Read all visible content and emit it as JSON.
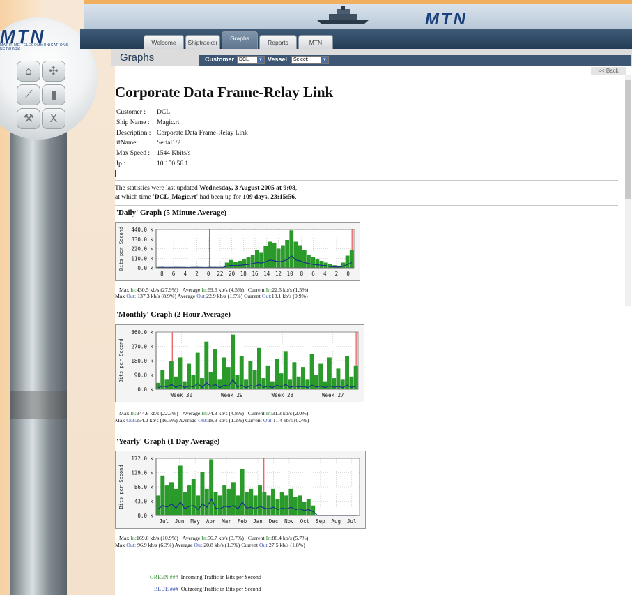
{
  "brand": {
    "logo": "MTN",
    "tagline": "MARITIME TELECOMMUNICATIONS NETWORK"
  },
  "nav": {
    "tabs": [
      {
        "label": "Welcome",
        "active": false
      },
      {
        "label": "Shiptracker",
        "active": false
      },
      {
        "label": "Graphs",
        "active": true
      },
      {
        "label": "Reports",
        "active": false
      },
      {
        "label": "MTN",
        "active": false
      }
    ]
  },
  "subbar": {
    "title": "Graphs",
    "customer_label": "Customer",
    "customer_value": "DCL",
    "vessel_label": "Vessel",
    "vessel_value": "Select:"
  },
  "back_label": "<< Back",
  "side_icons": [
    "home-icon",
    "network-icon",
    "graph-icon",
    "bar-chart-icon",
    "tools-icon",
    "close-icon"
  ],
  "page": {
    "heading": "Corporate Data Frame-Relay Link",
    "info": [
      {
        "key": "Customer :",
        "value": "DCL"
      },
      {
        "key": "Ship Name :",
        "value": "Magic.rt"
      },
      {
        "key": "Description :",
        "value": "Corporate Data Frame-Relay Link"
      },
      {
        "key": "ifName :",
        "value": "Serial1/2"
      },
      {
        "key": "Max Speed :",
        "value": "1544 Kbits/s"
      },
      {
        "key": "Ip :",
        "value": "10.150.56.1"
      }
    ],
    "stats_line1_pre": "The statistics were last updated ",
    "stats_line1_bold": "Wednesday, 3 August 2005 at 9:08",
    "stats_line1_post": ",",
    "stats_line2_pre": "at which time ",
    "stats_line2_bold1": "'DCL_Magic.rt'",
    "stats_line2_mid": " had been up for ",
    "stats_line2_bold2": "109 days, 23:15:56",
    "stats_line2_post": "."
  },
  "colors": {
    "incoming": "#2a9a2a",
    "outgoing": "#1b2f8a",
    "highlight": "#e03030"
  },
  "graphs": [
    {
      "title": "'Daily' Graph (5 Minute Average)",
      "ylabel": "Bits per Second",
      "yticks": [
        "440.0 k",
        "330.0 k",
        "220.0 k",
        "110.0 k",
        "0.0 k"
      ],
      "xticks": [
        "8",
        "6",
        "4",
        "2",
        "0",
        "22",
        "20",
        "18",
        "16",
        "14",
        "12",
        "10",
        "8",
        "6",
        "4",
        "2",
        "0"
      ],
      "max_line": {
        "l1": "Max",
        "in_lbl": "In:",
        "in_val": "430.5 kb/s (27.9%)",
        "a1": "Average",
        "ain_lbl": "In:",
        "ain_val": "69.6 kb/s (4.5%)",
        "c1": "Current",
        "cin_lbl": "In:",
        "cin_val": "22.5 kb/s (1.5%)"
      },
      "out_line": {
        "l1": "Max",
        "out_lbl": "Out:",
        "out_val": " 137.3 kb/s (8.9%)",
        "a1": "Average",
        "aout_lbl": "Out:",
        "aout_val": "22.9 kb/s (1.5%)",
        "c1": "Current",
        "cout_lbl": "Out:",
        "cout_val": "13.1 kb/s (0.9%)"
      },
      "chart_data": {
        "type": "area",
        "series": [
          {
            "name": "In",
            "values": [
              10,
              12,
              8,
              9,
              11,
              10,
              9,
              8,
              10,
              12,
              9,
              8,
              11,
              10,
              9,
              10,
              60,
              90,
              70,
              80,
              100,
              120,
              150,
              200,
              180,
              250,
              300,
              280,
              220,
              260,
              320,
              430,
              300,
              260,
              200,
              150,
              120,
              100,
              80,
              60,
              40,
              30,
              25,
              60,
              140,
              200
            ]
          },
          {
            "name": "Out",
            "values": [
              5,
              6,
              5,
              5,
              6,
              5,
              5,
              4,
              5,
              6,
              5,
              4,
              6,
              5,
              5,
              5,
              20,
              30,
              25,
              30,
              35,
              40,
              50,
              60,
              55,
              70,
              90,
              80,
              70,
              75,
              95,
              137,
              90,
              80,
              60,
              50,
              40,
              35,
              30,
              25,
              15,
              12,
              10,
              20,
              40,
              60
            ]
          }
        ],
        "ylim": [
          0,
          440
        ]
      }
    },
    {
      "title": "'Monthly' Graph (2 Hour Average)",
      "ylabel": "Bits per Second",
      "yticks": [
        "360.0 k",
        "270.0 k",
        "180.0 k",
        "90.0 k",
        "0.0 k"
      ],
      "xticks": [
        "Week 30",
        "Week 29",
        "Week 28",
        "Week 27"
      ],
      "max_line": {
        "l1": "Max",
        "in_lbl": "In:",
        "in_val": "344.6 kb/s (22.3%)",
        "a1": "Average",
        "ain_lbl": "In:",
        "ain_val": "74.3 kb/s (4.8%)",
        "c1": "Current",
        "cin_lbl": "In:",
        "cin_val": "31.3 kb/s (2.0%)"
      },
      "out_line": {
        "l1": "Max",
        "out_lbl": "Out:",
        "out_val": "254.2 kb/s (16.5%)",
        "a1": "Average",
        "aout_lbl": "Out:",
        "aout_val": "18.3 kb/s (1.2%)",
        "c1": "Current",
        "cout_lbl": "Out:",
        "cout_val": "11.4 kb/s (0.7%)"
      },
      "chart_data": {
        "type": "area",
        "series": [
          {
            "name": "In",
            "values": [
              40,
              120,
              60,
              180,
              80,
              200,
              50,
              160,
              90,
              230,
              70,
              300,
              110,
              250,
              60,
              200,
              140,
              344,
              90,
              210,
              60,
              180,
              120,
              260,
              70,
              150,
              50,
              190,
              100,
              240,
              60,
              170,
              80,
              140,
              60,
              220,
              90,
              160,
              50,
              200,
              70,
              130,
              60,
              210,
              80,
              150
            ]
          },
          {
            "name": "Out",
            "values": [
              10,
              20,
              15,
              30,
              12,
              25,
              10,
              20,
              15,
              35,
              12,
              40,
              18,
              30,
              10,
              25,
              20,
              60,
              15,
              25,
              10,
              22,
              18,
              30,
              12,
              20,
              10,
              25,
              15,
              30,
              12,
              20,
              14,
              18,
              10,
              25,
              14,
              20,
              10,
              22,
              12,
              18,
              10,
              25,
              12,
              20
            ]
          }
        ],
        "ylim": [
          0,
          360
        ]
      }
    },
    {
      "title": "'Yearly' Graph (1 Day Average)",
      "ylabel": "Bits per Second",
      "yticks": [
        "172.0 k",
        "129.0 k",
        "86.0 k",
        "43.0 k",
        "0.0 k"
      ],
      "xticks": [
        "Jul",
        "Jun",
        "May",
        "Apr",
        "Mar",
        "Feb",
        "Jan",
        "Dec",
        "Nov",
        "Oct",
        "Sep",
        "Aug",
        "Jul"
      ],
      "max_line": {
        "l1": "Max",
        "in_lbl": "In:",
        "in_val": "169.0 kb/s (10.9%)",
        "a1": "Average",
        "ain_lbl": "In:",
        "ain_val": "56.7 kb/s (3.7%)",
        "c1": "Current",
        "cin_lbl": "In:",
        "cin_val": "88.4 kb/s (5.7%)"
      },
      "out_line": {
        "l1": "Max",
        "out_lbl": "Out:",
        "out_val": "  96.9 kb/s (6.3%)",
        "a1": "Average",
        "aout_lbl": "Out:",
        "aout_val": "20.8 kb/s (1.3%)",
        "c1": "Current",
        "cout_lbl": "Out:",
        "cout_val": "27.5 kb/s (1.8%)"
      },
      "chart_data": {
        "type": "area",
        "series": [
          {
            "name": "In",
            "values": [
              60,
              120,
              90,
              100,
              80,
              150,
              70,
              90,
              110,
              60,
              130,
              80,
              169,
              70,
              60,
              90,
              80,
              100,
              60,
              140,
              70,
              80,
              60,
              90,
              70,
              60,
              80,
              50,
              70,
              60,
              80,
              55,
              60,
              40,
              50,
              30,
              0,
              0,
              0,
              0,
              0,
              0,
              0,
              0,
              0,
              0
            ]
          },
          {
            "name": "Out",
            "values": [
              20,
              30,
              25,
              35,
              22,
              40,
              20,
              28,
              30,
              18,
              35,
              25,
              50,
              22,
              20,
              28,
              25,
              30,
              20,
              40,
              22,
              25,
              20,
              28,
              22,
              20,
              25,
              18,
              22,
              20,
              25,
              18,
              20,
              15,
              18,
              12,
              0,
              0,
              0,
              0,
              0,
              0,
              0,
              0,
              0,
              0
            ]
          }
        ],
        "ylim": [
          0,
          172
        ]
      }
    }
  ],
  "legend": [
    {
      "label": "GREEN ###",
      "text": "Incoming Traffic in Bits per Second"
    },
    {
      "label": "BLUE ###",
      "text": "Outgoing Traffic in Bits per Second"
    }
  ]
}
